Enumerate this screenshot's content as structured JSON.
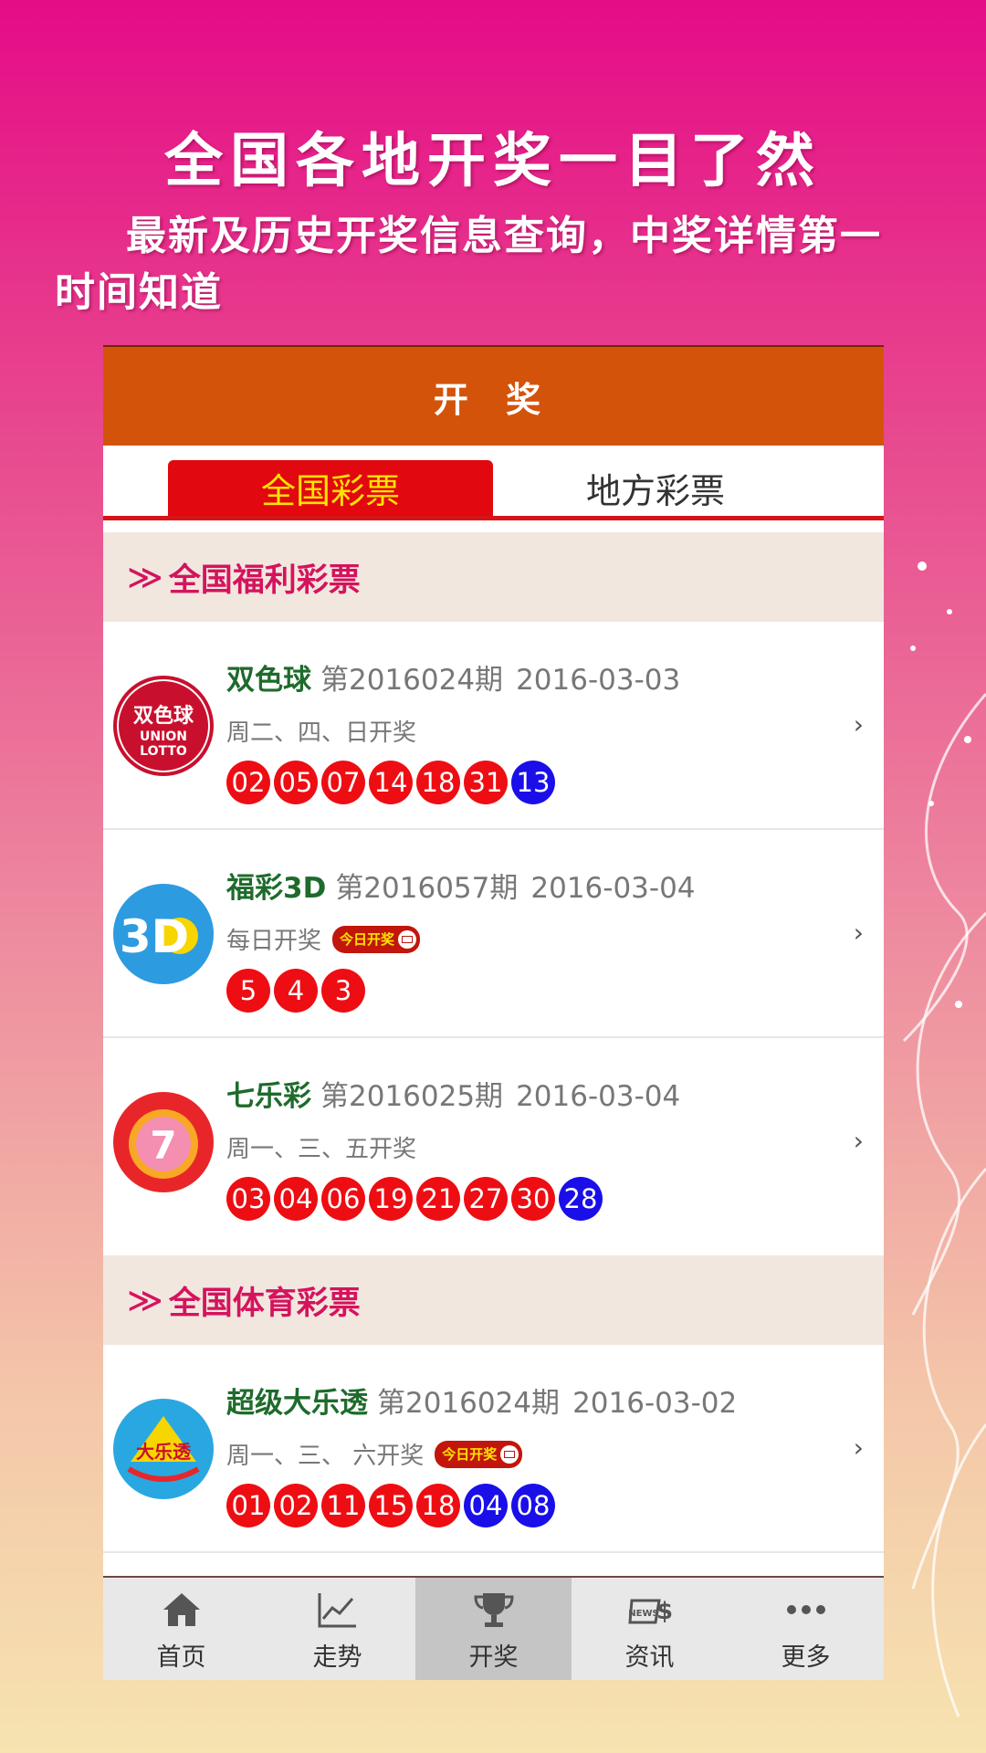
{
  "promo": {
    "headline": "全国各地开奖一目了然",
    "subline": "最新及历史开奖信息查询，中奖详情第一时间知道"
  },
  "app": {
    "title": "开 奖",
    "tabs": [
      {
        "label": "全国彩票",
        "active": true
      },
      {
        "label": "地方彩票",
        "active": false
      }
    ],
    "sections": [
      {
        "title": "全国福利彩票",
        "items": [
          {
            "name": "双色球",
            "issue": "第2016024期",
            "date": "2016-03-03",
            "schedule": "周二、四、日开奖",
            "badge": "",
            "logo_text": "双色球",
            "red": [
              "02",
              "05",
              "07",
              "14",
              "18",
              "31"
            ],
            "blue": [
              "13"
            ]
          },
          {
            "name": "福彩3D",
            "issue": "第2016057期",
            "date": "2016-03-04",
            "schedule": "每日开奖",
            "badge": "今日开奖",
            "logo_text": "3D",
            "red": [
              "5",
              "4",
              "3"
            ],
            "blue": []
          },
          {
            "name": "七乐彩",
            "issue": "第2016025期",
            "date": "2016-03-04",
            "schedule": "周一、三、五开奖",
            "badge": "",
            "logo_text": "7乐彩",
            "red": [
              "03",
              "04",
              "06",
              "19",
              "21",
              "27",
              "30"
            ],
            "blue": [
              "28"
            ]
          }
        ]
      },
      {
        "title": "全国体育彩票",
        "items": [
          {
            "name": "超级大乐透",
            "issue": "第2016024期",
            "date": "2016-03-02",
            "schedule": "周一、三、 六开奖",
            "badge": "今日开奖",
            "logo_text": "大乐透",
            "red": [
              "01",
              "02",
              "11",
              "15",
              "18"
            ],
            "blue": [
              "04",
              "08"
            ]
          }
        ]
      }
    ],
    "nav": [
      {
        "label": "首页",
        "icon": "home-icon",
        "active": false
      },
      {
        "label": "走势",
        "icon": "trend-chart-icon",
        "active": false
      },
      {
        "label": "开奖",
        "icon": "trophy-icon",
        "active": true
      },
      {
        "label": "资讯",
        "icon": "news-icon",
        "active": false
      },
      {
        "label": "更多",
        "icon": "more-dots-icon",
        "active": false
      }
    ]
  }
}
